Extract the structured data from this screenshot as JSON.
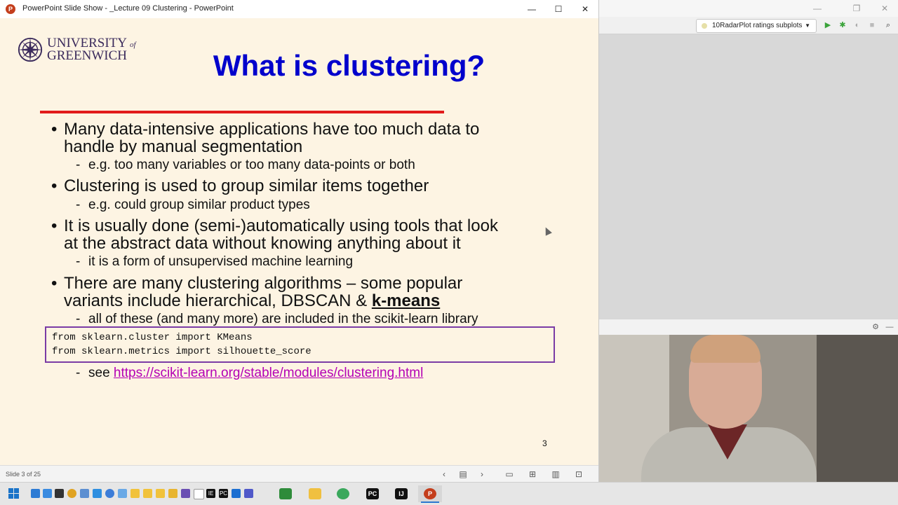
{
  "ppt_window": {
    "title": "PowerPoint Slide Show  -  _Lecture 09 Clustering - PowerPoint",
    "app_icon_glyph": "P",
    "controls": {
      "minimize": "—",
      "maximize": "☐",
      "close": "✕"
    }
  },
  "slide": {
    "logo": {
      "line1_main": "UNIVERSITY",
      "line1_of": "of",
      "line2": "GREENWICH"
    },
    "title": "What is clustering?",
    "bullets": [
      {
        "lines": [
          "Many data-intensive applications have too much data to",
          "handle by manual segmentation"
        ],
        "sub": [
          "e.g. too many variables or too many data-points or both"
        ]
      },
      {
        "lines": [
          "Clustering is used to group similar items together"
        ],
        "sub": [
          "e.g. could group similar product types"
        ]
      },
      {
        "lines": [
          "It is usually done (semi-)automatically using tools that look",
          "at the abstract data without knowing anything about it"
        ],
        "sub": [
          "it is a form of unsupervised machine learning"
        ]
      },
      {
        "lines": [
          "There are many clustering algorithms – some popular"
        ],
        "line2_prefix": "variants include hierarchical, DBSCAN & ",
        "line2_emph": "k-means",
        "sub": [
          "all of these (and many more) are included in the scikit-learn library"
        ]
      }
    ],
    "code_lines": [
      "from sklearn.cluster import KMeans",
      "from sklearn.metrics import silhouette_score"
    ],
    "see_prefix": "see ",
    "see_link": "https://scikit-learn.org/stable/modules/clustering.html",
    "page_number": "3"
  },
  "status_bar": {
    "slide_counter": "Slide 3 of 25",
    "icons": [
      "prev-icon",
      "slide-menu-icon",
      "next-icon",
      "normal-view-icon",
      "slide-sorter-icon",
      "reading-view-icon",
      "slideshow-icon"
    ]
  },
  "ide": {
    "run_config": "10RadarPlot ratings subplots",
    "icons": [
      "run-icon",
      "debug-icon",
      "coverage-icon",
      "stop-icon",
      "search-icon",
      "settings-icon",
      "hide-icon"
    ]
  },
  "taskbar": {
    "apps": [
      "file-explorer",
      "chrome",
      "pycharm",
      "intellij",
      "powerpoint"
    ],
    "active_app": "powerpoint"
  },
  "colors": {
    "slide_bg": "#fdf4e3",
    "title_blue": "#0000cc",
    "rule_red": "#e11b1b",
    "code_border": "#7a3ba5",
    "link_magenta": "#b400b4",
    "ppt_orange": "#c43e1c"
  }
}
